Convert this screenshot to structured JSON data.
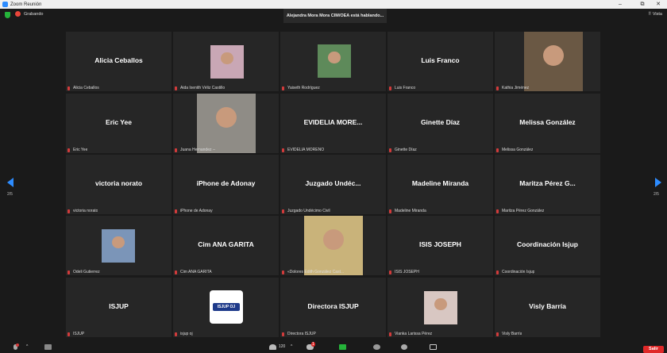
{
  "window": {
    "title": "Zoom Reunión",
    "minimize": "–",
    "maximize": "⧉",
    "close": "✕"
  },
  "status": {
    "recording": "Grabando",
    "speaking": "Alejandra Mora Mora CIM/OEA está hablando...",
    "view": "Vista"
  },
  "pager": {
    "left": "2/5",
    "right": "2/5"
  },
  "participants": [
    {
      "big": "Alicia Ceballos",
      "label": "Alicia Ceballos"
    },
    {
      "big": "",
      "label": "Aida Ixenith Véliz Castillo"
    },
    {
      "big": "",
      "label": "Yaiseth Rodríguez"
    },
    {
      "big": "Luis Franco",
      "label": "Luis Franco"
    },
    {
      "big": "",
      "label": "Kathia Jiménez"
    },
    {
      "big": "Eric Yee",
      "label": "Eric Yee"
    },
    {
      "big": "",
      "label": "Juana Hernandez --"
    },
    {
      "big": "EVIDELIA MORE...",
      "label": "EVIDELIA MORENO"
    },
    {
      "big": "Ginette Díaz",
      "label": "Ginette Díaz"
    },
    {
      "big": "Melissa González",
      "label": "Melissa González"
    },
    {
      "big": "victoria norato",
      "label": "victoria norato"
    },
    {
      "big": "iPhone de Adonay",
      "label": "iPhone de Adonay"
    },
    {
      "big": "Juzgado Undéc...",
      "label": "Juzgado Undécimo Civil"
    },
    {
      "big": "Madeline Miranda",
      "label": "Madeline Miranda"
    },
    {
      "big": "Maritza Pérez G...",
      "label": "Maritza Pérez González"
    },
    {
      "big": "",
      "label": "Odeli Gutierrez"
    },
    {
      "big": "Cim ANA GARITA",
      "label": "Cim ANA GARITA"
    },
    {
      "big": "",
      "label": "«Dolores Edith González Cast..."
    },
    {
      "big": "ISIS JOSEPH",
      "label": "ISIS JOSEPH"
    },
    {
      "big": "Coordinación Isjup",
      "label": "Coordinación Isjup"
    },
    {
      "big": "ISJUP",
      "label": "ISJUP"
    },
    {
      "big": "",
      "label": "isjup oj"
    },
    {
      "big": "Directora ISJUP",
      "label": "Directora ISJUP"
    },
    {
      "big": "",
      "label": "Vianka Larissa Pérez"
    },
    {
      "big": "Visly Barría",
      "label": "Visly Barría"
    }
  ],
  "logo": {
    "text": "ISJUP OJ"
  },
  "toolbar": {
    "participants_count": "120",
    "chat_badge": "1",
    "leave": "Salir"
  },
  "colors": {
    "accent": "#2d8cff",
    "mic_muted": "#d23b3b",
    "leave": "#e02828",
    "share": "#25b33a"
  }
}
